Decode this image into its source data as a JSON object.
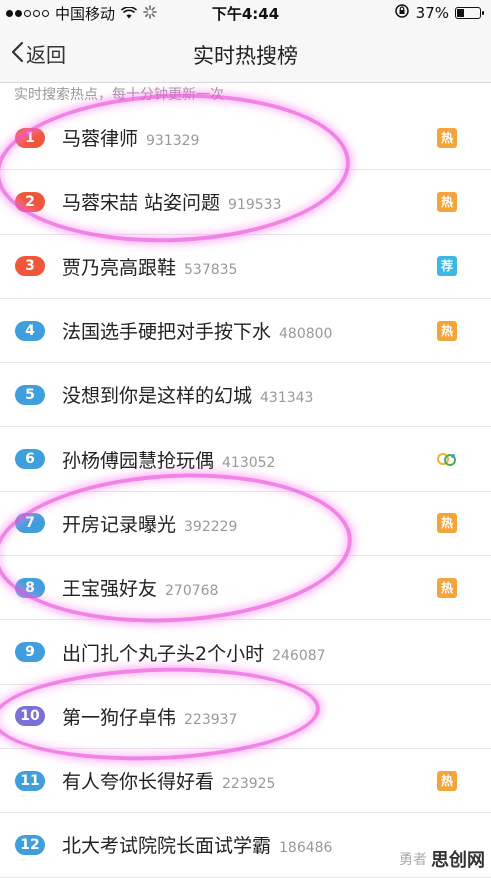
{
  "status_bar": {
    "carrier": "中国移动",
    "time": "下午4:44",
    "battery": "37%",
    "battery_level": 0.37
  },
  "nav": {
    "back_label": "返回",
    "title": "实时热搜榜"
  },
  "hint": "实时搜索热点，每十分钟更新一次",
  "list": [
    {
      "rank": "1",
      "title": "马蓉律师",
      "count": "931329",
      "rank_color": "#f0573a",
      "badge": "热",
      "badge_color": "#f3a53c"
    },
    {
      "rank": "2",
      "title": "马蓉宋喆 站姿问题",
      "count": "919533",
      "rank_color": "#f0573a",
      "badge": "热",
      "badge_color": "#f3a53c"
    },
    {
      "rank": "3",
      "title": "贾乃亮高跟鞋",
      "count": "537835",
      "rank_color": "#f0573a",
      "badge": "荐",
      "badge_color": "#3cb7e6"
    },
    {
      "rank": "4",
      "title": "法国选手硬把对手按下水",
      "count": "480800",
      "rank_color": "#3f9fdc",
      "badge": "热",
      "badge_color": "#f3a53c"
    },
    {
      "rank": "5",
      "title": "没想到你是这样的幻城",
      "count": "431343",
      "rank_color": "#3f9fdc",
      "badge": "",
      "badge_color": ""
    },
    {
      "rank": "6",
      "title": "孙杨傅园慧抢玩偶",
      "count": "413052",
      "rank_color": "#3f9fdc",
      "badge": "olympic",
      "badge_color": ""
    },
    {
      "rank": "7",
      "title": "开房记录曝光",
      "count": "392229",
      "rank_color": "#3f9fdc",
      "badge": "热",
      "badge_color": "#f3a53c"
    },
    {
      "rank": "8",
      "title": "王宝强好友",
      "count": "270768",
      "rank_color": "#3f9fdc",
      "badge": "热",
      "badge_color": "#f3a53c"
    },
    {
      "rank": "9",
      "title": "出门扎个丸子头2个小时",
      "count": "246087",
      "rank_color": "#3f9fdc",
      "badge": "",
      "badge_color": ""
    },
    {
      "rank": "10",
      "title": "第一狗仔卓伟",
      "count": "223937",
      "rank_color": "#7b6fd8",
      "badge": "",
      "badge_color": ""
    },
    {
      "rank": "11",
      "title": "有人夸你长得好看",
      "count": "223925",
      "rank_color": "#3f9fdc",
      "badge": "热",
      "badge_color": "#f3a53c"
    },
    {
      "rank": "12",
      "title": "北大考试院院长面试学霸",
      "count": "186486",
      "rank_color": "#3f9fdc",
      "badge": "",
      "badge_color": ""
    }
  ],
  "watermark": {
    "small": "勇者",
    "big": "思创网"
  }
}
